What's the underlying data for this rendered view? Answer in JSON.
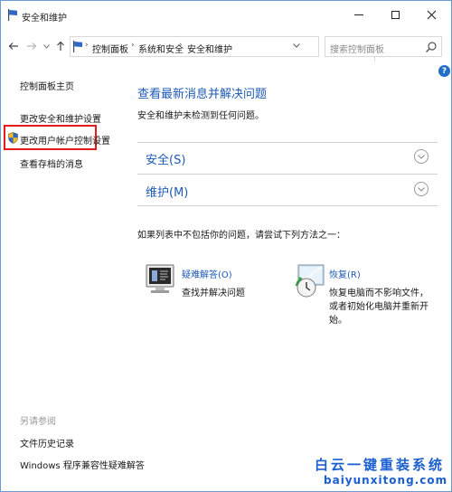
{
  "window": {
    "title": "安全和维护"
  },
  "address": {
    "crumbs": [
      "控制面板",
      "系统和安全",
      "安全和维护"
    ],
    "search_placeholder": "搜索控制面板"
  },
  "help": {
    "label": "?"
  },
  "left_panel": {
    "home": "控制面板主页",
    "change_security": "更改安全和维护设置",
    "change_uac": "更改用户帐户控制设置",
    "view_archived": "查看存档的消息",
    "see_also": "另请参阅",
    "file_history": "文件历史记录",
    "compat_troubleshooter": "Windows 程序兼容性疑难解答"
  },
  "main": {
    "title": "查看最新消息并解决问题",
    "subtitle": "安全和维护未检测到任何问题。",
    "sections": [
      {
        "label": "安全(S)"
      },
      {
        "label": "维护(M)"
      }
    ],
    "hint": "如果列表中不包括你的问题，请尝试下列方法之一：",
    "troubleshoot": {
      "title": "疑难解答(O)",
      "desc": "查找并解决问题"
    },
    "recovery": {
      "title": "恢复(R)",
      "desc_lines": [
        "恢复电脑而不影响文件，",
        "或者初始化电脑并重新开",
        "始。"
      ]
    }
  },
  "watermark": {
    "text": "白云一键重装系统",
    "url": "baiyunxitong.com"
  },
  "colors": {
    "link_blue": "#1e5ab5",
    "highlight_red": "#e31b1b"
  }
}
